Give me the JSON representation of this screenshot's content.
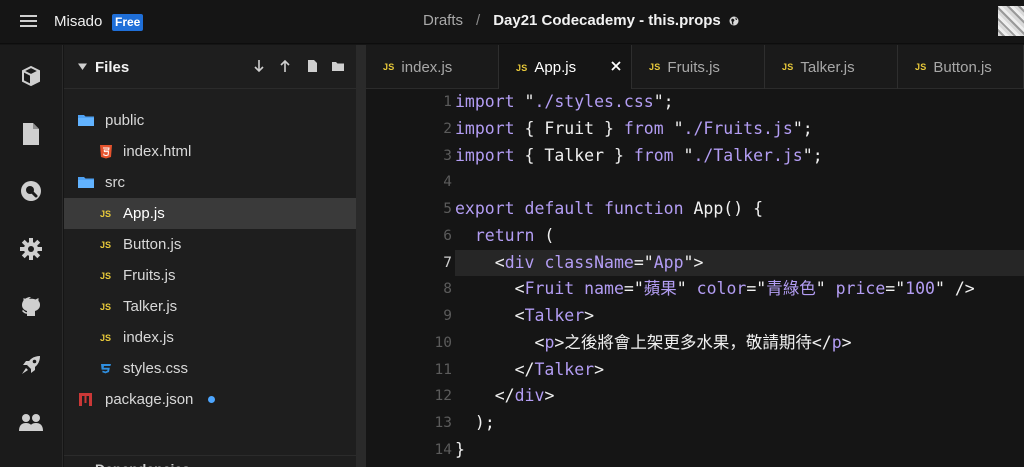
{
  "topbar": {
    "brand": "Misado",
    "badge": "Free",
    "breadcrumb_parent": "Drafts",
    "breadcrumb_separator": "/",
    "breadcrumb_title": "Day21 Codecademy - this.props"
  },
  "rail": {
    "icons": [
      "cube-icon",
      "file-icon",
      "search-icon",
      "gear-icon",
      "github-icon",
      "rocket-icon",
      "users-icon"
    ]
  },
  "files": {
    "title": "Files",
    "items": [
      {
        "label": "public",
        "icon": "folder-icon",
        "selected": false
      },
      {
        "label": "index.html",
        "icon": "html5-icon",
        "selected": false
      },
      {
        "label": "src",
        "icon": "folder-icon",
        "selected": false
      },
      {
        "label": "App.js",
        "icon": "js-icon",
        "selected": true
      },
      {
        "label": "Button.js",
        "icon": "js-icon",
        "selected": false
      },
      {
        "label": "Fruits.js",
        "icon": "js-icon",
        "selected": false
      },
      {
        "label": "Talker.js",
        "icon": "js-icon",
        "selected": false
      },
      {
        "label": "index.js",
        "icon": "js-icon",
        "selected": false
      },
      {
        "label": "styles.css",
        "icon": "css3-icon",
        "selected": false
      },
      {
        "label": "package.json",
        "icon": "npm-icon",
        "selected": false,
        "modified": true
      }
    ],
    "footer_partial": "Dependencies"
  },
  "tabs": [
    {
      "badge": "JS",
      "label": "index.js",
      "active": false
    },
    {
      "badge": "JS",
      "label": "App.js",
      "active": true
    },
    {
      "badge": "JS",
      "label": "Fruits.js",
      "active": false
    },
    {
      "badge": "JS",
      "label": "Talker.js",
      "active": false
    },
    {
      "badge": "JS",
      "label": "Button.js",
      "active": false
    }
  ],
  "editor": {
    "current_line": 7,
    "lines": [
      {
        "n": "1",
        "text": "import \"./styles.css\";"
      },
      {
        "n": "2",
        "text": "import { Fruit } from \"./Fruits.js\";"
      },
      {
        "n": "3",
        "text": "import { Talker } from \"./Talker.js\";"
      },
      {
        "n": "4",
        "text": ""
      },
      {
        "n": "5",
        "text": "export default function App() {"
      },
      {
        "n": "6",
        "text": "  return ("
      },
      {
        "n": "7",
        "text": "    <div className=\"App\">"
      },
      {
        "n": "8",
        "text": "      <Fruit name=\"蘋果\" color=\"青綠色\" price=\"100\" />"
      },
      {
        "n": "9",
        "text": "      <Talker>"
      },
      {
        "n": "10",
        "text": "        <p>之後將會上架更多水果，敬請期待</p>"
      },
      {
        "n": "11",
        "text": "      </Talker>"
      },
      {
        "n": "12",
        "text": "    </div>"
      },
      {
        "n": "13",
        "text": "  );"
      },
      {
        "n": "14",
        "text": "}"
      }
    ]
  },
  "colors": {
    "background": "#151515",
    "panel": "#1e1e1e",
    "accent_blue": "#1f6fd8",
    "syntax_purple": "#b39df3",
    "js_yellow": "#e8c93a",
    "html_orange": "#e5532d",
    "css_blue": "#2f8fe0",
    "npm_red": "#cb3837"
  }
}
